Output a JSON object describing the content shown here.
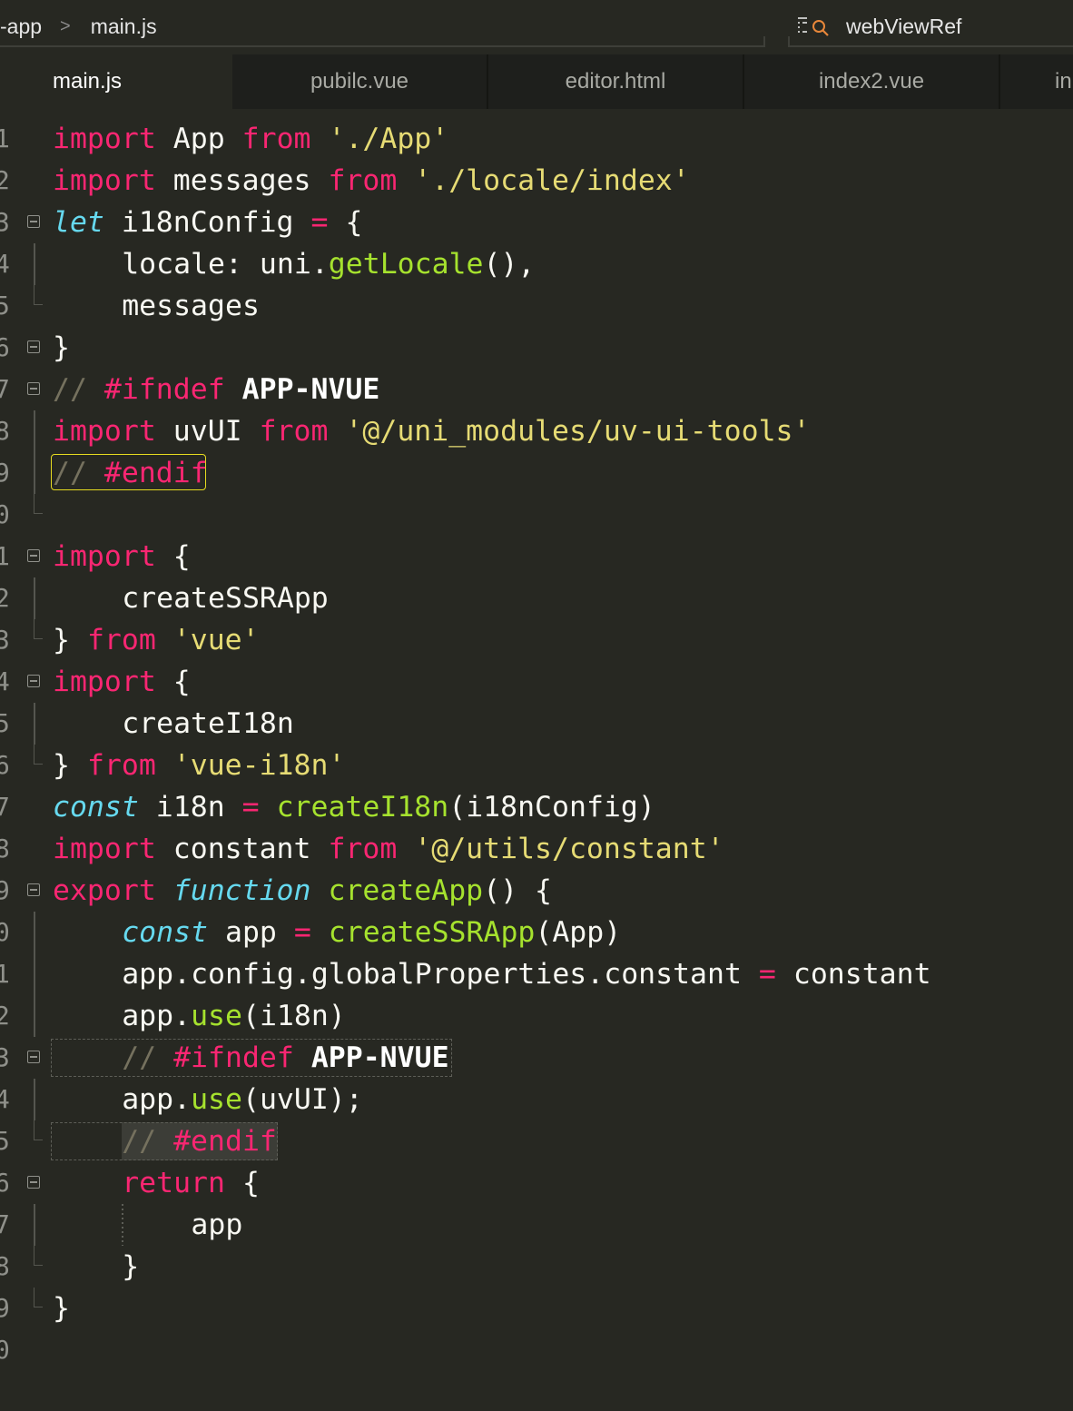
{
  "breadcrumb": [
    "-app",
    "main.js"
  ],
  "breadcrumb_separator": ">",
  "symbol_search": {
    "label": "webViewRef",
    "icon": "symbol-search-icon"
  },
  "tabs": [
    {
      "label": "main.js",
      "active": true
    },
    {
      "label": "pubilc.vue",
      "active": false
    },
    {
      "label": "editor.html",
      "active": false
    },
    {
      "label": "index2.vue",
      "active": false
    },
    {
      "label": "in",
      "active": false
    }
  ],
  "editor": {
    "lines": [
      {
        "num": "1",
        "text": "import App from './App'"
      },
      {
        "num": "2",
        "text": "import messages from './locale/index'"
      },
      {
        "num": "3",
        "text": "let i18nConfig = {"
      },
      {
        "num": "4",
        "text": "locale: uni.getLocale(),"
      },
      {
        "num": "5",
        "text": "messages"
      },
      {
        "num": "6",
        "text": "}"
      },
      {
        "num": "7",
        "text": "// #ifndef APP-NVUE"
      },
      {
        "num": "8",
        "text": "import uvUI from '@/uni_modules/uv-ui-tools'"
      },
      {
        "num": "9",
        "text": "// #endif"
      },
      {
        "num": "0",
        "text": ""
      },
      {
        "num": "1",
        "text": "import {"
      },
      {
        "num": "2",
        "text": "createSSRApp"
      },
      {
        "num": "3",
        "text": "} from 'vue'"
      },
      {
        "num": "4",
        "text": "import {"
      },
      {
        "num": "5",
        "text": "createI18n"
      },
      {
        "num": "6",
        "text": "} from 'vue-i18n'"
      },
      {
        "num": "7",
        "text": "const i18n = createI18n(i18nConfig)"
      },
      {
        "num": "8",
        "text": "import constant from '@/utils/constant'"
      },
      {
        "num": "9",
        "text": "export function createApp() {"
      },
      {
        "num": "0",
        "text": "const app = createSSRApp(App)"
      },
      {
        "num": "1",
        "text": "app.config.globalProperties.constant = constant"
      },
      {
        "num": "2",
        "text": "app.use(i18n)"
      },
      {
        "num": "3",
        "text": "// #ifndef APP-NVUE"
      },
      {
        "num": "4",
        "text": "app.use(uvUI);"
      },
      {
        "num": "5",
        "text": "// #endif"
      },
      {
        "num": "6",
        "text": "return {"
      },
      {
        "num": "7",
        "text": "app"
      },
      {
        "num": "8",
        "text": "}"
      },
      {
        "num": "9",
        "text": "}"
      },
      {
        "num": "0",
        "text": ""
      }
    ]
  },
  "colors": {
    "background": "#272822",
    "keyword": "#f92672",
    "string": "#e6db74",
    "function": "#a6e22e",
    "type": "#66d9ef",
    "comment": "#75715e",
    "highlight_box": "#e6db20"
  }
}
